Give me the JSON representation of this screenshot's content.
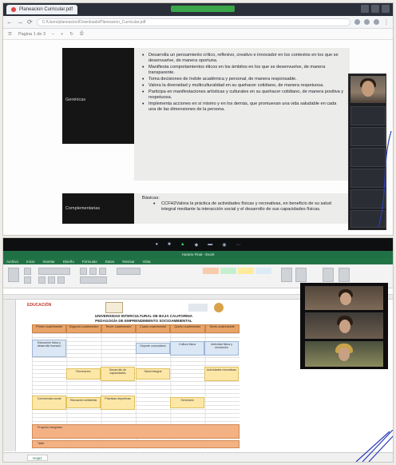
{
  "top": {
    "tab_title": "Planeacion Curricular.pdf",
    "url": "C:/Users/planeacion/Downloads/Planeacion_Curricular.pdf",
    "pdf_toolbar_label": "Pagina 1 de 3",
    "left_labels": {
      "generic": "Genéricas",
      "complementary": "Complementarias"
    },
    "generic_competences": [
      "Desarrolla un pensamiento crítico, reflexivo, creativo e innovador en los contextos en los que se desenvuelve, de manera oportuna.",
      "Manifiesta comportamientos éticos en los ámbitos en los que se desenvuelve, de manera transparente.",
      "Toma decisiones de índole académica y personal, de manera responsable.",
      "Valora la diversidad y multiculturalidad en su quehacer cotidiano, de manera respetuosa.",
      "Participa en manifestaciones artísticas y culturales en su quehacer cotidiano, de manera positiva y respetuosa.",
      "Implementa acciones en sí mismo y en los demás, que promuevan una vida saludable en cada una de las dimensiones de la persona."
    ],
    "basic": {
      "title": "Básicas:",
      "item": "CCFH2Valora la práctica de actividades físicas y recreativas, en beneficio de su salud integral mediante la interacción social y el desarrollo de sus capacidades físicas."
    }
  },
  "bottom": {
    "window_title": "Horario Final - Excel",
    "menu": [
      "Archivo",
      "Inicio",
      "Insertar",
      "Diseño",
      "Fórmulas",
      "Datos",
      "Revisar",
      "Vista"
    ],
    "formula_text": "",
    "logo_left": "EDUCACIÓN",
    "header_line1": "UNIVERSIDAD INTERCULTURAL DE BAJA CALIFORNIA",
    "header_line2": "PEDAGOGÍA DE EMPRENDIMIENTO SOCIOAMBIENTAL",
    "days": [
      "Primer cuatrimestre",
      "Segundo cuatrimestre",
      "Tercer cuatrimestre",
      "Cuarto cuatrimestre",
      "Quinto cuatrimestre",
      "Sexto cuatrimestre"
    ],
    "cells": {
      "c1": "Educación física y desarrollo humano",
      "c2": "Deporte comunitario",
      "c3": "Cultura física",
      "c4": "Actividad física y recreación",
      "c5": "Recreación",
      "c6": "Desarrollo de capacidades",
      "c7": "Salud integral",
      "c8": "Actividades recreativas",
      "c9": "Convivencia social",
      "c10": "Educación ambiental",
      "c11": "Prácticas deportivas",
      "c12": "Seminario",
      "c13": "Proyecto integrador",
      "c14": "Taller"
    },
    "sheet_tab": "Hoja1"
  }
}
